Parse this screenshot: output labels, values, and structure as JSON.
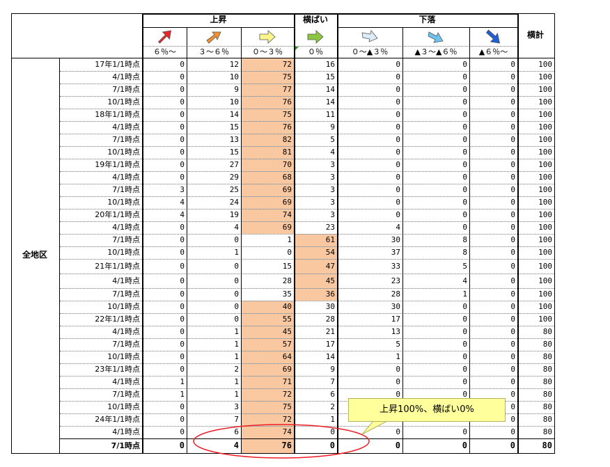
{
  "header": {
    "group_up": "上昇",
    "group_flat": "横ばい",
    "group_down": "下落",
    "total": "横計",
    "columns": [
      "６％～",
      "３～６％",
      "０～３％",
      "０％",
      "０～▲３％",
      "▲３～▲６％",
      "▲６％～"
    ]
  },
  "icons": [
    "arrow-up-right-red-icon",
    "arrow-up-right-orange-icon",
    "arrow-right-yellow-icon",
    "arrow-right-green-icon",
    "arrow-right-lightblue-icon",
    "arrow-down-right-blue-icon",
    "arrow-down-right-darkblue-icon"
  ],
  "icon_colors": [
    "#e8262c",
    "#f39130",
    "#fbf58a",
    "#8cc63f",
    "#d9ecf7",
    "#6cc4ee",
    "#1f5fd6"
  ],
  "highlight_color": "#f9c7a0",
  "region": "全地区",
  "rows": [
    {
      "label": "17年1/1時点",
      "values": [
        0,
        12,
        72,
        16,
        0,
        0,
        0
      ],
      "total": 100,
      "hl": 2
    },
    {
      "label": "4/1時点",
      "values": [
        0,
        10,
        75,
        15,
        0,
        0,
        0
      ],
      "total": 100,
      "hl": 2
    },
    {
      "label": "7/1時点",
      "values": [
        0,
        9,
        77,
        14,
        0,
        0,
        0
      ],
      "total": 100,
      "hl": 2
    },
    {
      "label": "10/1時点",
      "values": [
        0,
        10,
        76,
        14,
        0,
        0,
        0
      ],
      "total": 100,
      "hl": 2
    },
    {
      "label": "18年1/1時点",
      "values": [
        0,
        14,
        75,
        11,
        0,
        0,
        0
      ],
      "total": 100,
      "hl": 2
    },
    {
      "label": "4/1時点",
      "values": [
        0,
        15,
        76,
        9,
        0,
        0,
        0
      ],
      "total": 100,
      "hl": 2
    },
    {
      "label": "7/1時点",
      "values": [
        0,
        13,
        82,
        5,
        0,
        0,
        0
      ],
      "total": 100,
      "hl": 2
    },
    {
      "label": "10/1時点",
      "values": [
        0,
        15,
        81,
        4,
        0,
        0,
        0
      ],
      "total": 100,
      "hl": 2
    },
    {
      "label": "19年1/1時点",
      "values": [
        0,
        27,
        70,
        3,
        0,
        0,
        0
      ],
      "total": 100,
      "hl": 2
    },
    {
      "label": "4/1時点",
      "values": [
        0,
        29,
        68,
        3,
        0,
        0,
        0
      ],
      "total": 100,
      "hl": 2
    },
    {
      "label": "7/1時点",
      "values": [
        3,
        25,
        69,
        3,
        0,
        0,
        0
      ],
      "total": 100,
      "hl": 2
    },
    {
      "label": "10/1時点",
      "values": [
        4,
        24,
        69,
        3,
        0,
        0,
        0
      ],
      "total": 100,
      "hl": 2
    },
    {
      "label": "20年1/1時点",
      "values": [
        4,
        19,
        74,
        3,
        0,
        0,
        0
      ],
      "total": 100,
      "hl": 2
    },
    {
      "label": "4/1時点",
      "values": [
        0,
        4,
        69,
        23,
        4,
        0,
        0
      ],
      "total": 100,
      "hl": 2
    },
    {
      "label": "7/1時点",
      "values": [
        0,
        0,
        1,
        61,
        30,
        8,
        0
      ],
      "total": 100,
      "hl": 3
    },
    {
      "label": "10/1時点",
      "values": [
        0,
        1,
        0,
        54,
        37,
        8,
        0
      ],
      "total": 100,
      "hl": 3
    },
    {
      "label": "21年1/1時点",
      "values": [
        0,
        0,
        15,
        47,
        33,
        5,
        0
      ],
      "total": 100,
      "hl": 3
    },
    {
      "label": "4/1時点",
      "values": [
        0,
        0,
        28,
        45,
        23,
        4,
        0
      ],
      "total": 100,
      "hl": 3
    },
    {
      "label": "7/1時点",
      "values": [
        0,
        0,
        35,
        36,
        28,
        1,
        0
      ],
      "total": 100,
      "hl": 3
    },
    {
      "label": "10/1時点",
      "values": [
        0,
        0,
        40,
        30,
        30,
        0,
        0
      ],
      "total": 100,
      "hl": 2
    },
    {
      "label": "22年1/1時点",
      "values": [
        0,
        0,
        55,
        28,
        17,
        0,
        0
      ],
      "total": 100,
      "hl": 2
    },
    {
      "label": "4/1時点",
      "values": [
        0,
        1,
        45,
        21,
        13,
        0,
        0
      ],
      "total": 80,
      "hl": 2
    },
    {
      "label": "7/1時点",
      "values": [
        0,
        1,
        57,
        17,
        5,
        0,
        0
      ],
      "total": 80,
      "hl": 2
    },
    {
      "label": "10/1時点",
      "values": [
        0,
        1,
        64,
        14,
        1,
        0,
        0
      ],
      "total": 80,
      "hl": 2
    },
    {
      "label": "23年1/1時点",
      "values": [
        0,
        2,
        69,
        9,
        0,
        0,
        0
      ],
      "total": 80,
      "hl": 2
    },
    {
      "label": "4/1時点",
      "values": [
        1,
        1,
        71,
        7,
        0,
        0,
        0
      ],
      "total": 80,
      "hl": 2
    },
    {
      "label": "7/1時点",
      "values": [
        1,
        1,
        72,
        6,
        0,
        0,
        0
      ],
      "total": 80,
      "hl": 2
    },
    {
      "label": "10/1時点",
      "values": [
        0,
        3,
        75,
        2,
        0,
        0,
        0
      ],
      "total": 80,
      "hl": 2
    },
    {
      "label": "24年1/1時点",
      "values": [
        0,
        7,
        72,
        1,
        0,
        0,
        0
      ],
      "total": 80,
      "hl": 2
    },
    {
      "label": "4/1時点",
      "values": [
        0,
        6,
        74,
        0,
        0,
        0,
        0
      ],
      "total": 80,
      "hl": 2
    },
    {
      "label": "7/1時点",
      "values": [
        0,
        4,
        76,
        0,
        0,
        0,
        0
      ],
      "total": 80,
      "hl": 2,
      "bold": true
    }
  ],
  "callout": {
    "text": "上昇100%、横ばい0%"
  }
}
